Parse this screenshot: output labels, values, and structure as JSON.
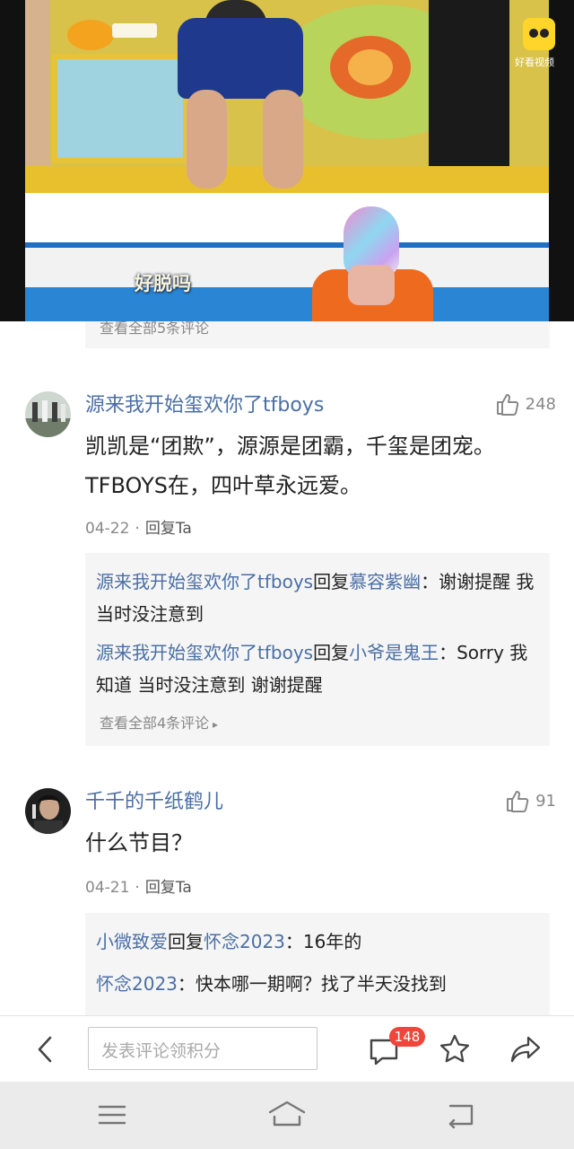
{
  "video": {
    "subtitle": "好脱吗",
    "brand_label": "好看视频",
    "brand_icon": "haokan-logo-icon",
    "station_icon": "hunan-tv-logo-icon"
  },
  "peek": {
    "more_label": "查看全部5条评论"
  },
  "comments": [
    {
      "username": "源来我开始玺欢你了tfboys",
      "likes": "248",
      "text": "凯凯是“团欺”，源源是团霸，千玺是团宠。TFBOYS在，四叶草永远爱。",
      "date": "04-22",
      "reply_label": "回复Ta",
      "replies": [
        {
          "author": "源来我开始玺欢你了tfboys",
          "verb": "回复",
          "target": "慕容紫幽",
          "sep": "：",
          "text": "谢谢提醒 我当时没注意到"
        },
        {
          "author": "源来我开始玺欢你了tfboys",
          "verb": "回复",
          "target": "小爷是鬼王",
          "sep": "：",
          "text": "Sorry 我知道 当时没注意到 谢谢提醒"
        }
      ],
      "more_label": "查看全部4条评论"
    },
    {
      "username": "千千的千纸鹤儿",
      "likes": "91",
      "text": "什么节目？",
      "date": "04-21",
      "reply_label": "回复Ta",
      "replies": [
        {
          "author": "小微致爱",
          "verb": "回复",
          "target": "怀念2023",
          "sep": "：",
          "text": "16年的"
        },
        {
          "author": "怀念2023",
          "verb": "",
          "target": "",
          "sep": "：",
          "text": "快本哪一期啊？找了半天没找到"
        }
      ]
    }
  ],
  "toolbar": {
    "input_placeholder": "发表评论领积分",
    "comment_count": "148"
  },
  "colors": {
    "link_blue": "#4a6fa5",
    "badge_red": "#f0453a",
    "reply_bg": "#f5f5f5"
  }
}
